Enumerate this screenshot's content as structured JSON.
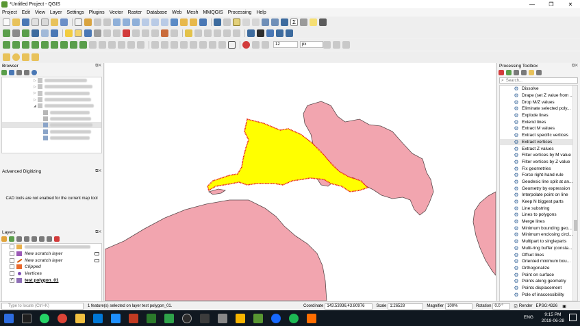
{
  "window": {
    "title": "*Untitled Project - QGIS",
    "controls": [
      "—",
      "❐",
      "✕"
    ]
  },
  "menu": [
    "Project",
    "Edit",
    "View",
    "Layer",
    "Settings",
    "Plugins",
    "Vector",
    "Raster",
    "Database",
    "Web",
    "Mesh",
    "MMQGIS",
    "Processing",
    "Help"
  ],
  "snapping": {
    "tolerance": "12",
    "units": "px"
  },
  "browser": {
    "title": "Browser"
  },
  "advanced_digitizing": {
    "title": "Advanced Digitizing",
    "message": "CAD tools are not enabled for the current map tool"
  },
  "layers": {
    "title": "Layers",
    "items": [
      {
        "name": "New scratch layer",
        "checked": false,
        "symbol": "polygon-fill",
        "color": "#9b59b6"
      },
      {
        "name": "New scratch layer",
        "checked": false,
        "symbol": "line",
        "color": "#d35400"
      },
      {
        "name": "Clipped",
        "checked": false,
        "symbol": "polygon-fill",
        "color": "#e8692c"
      },
      {
        "name": "Vertices",
        "checked": false,
        "symbol": "point",
        "color": "#7b4bb3"
      },
      {
        "name": "test polygon_01",
        "checked": true,
        "symbol": "polygon-fill",
        "color": "#8e6fb6"
      }
    ]
  },
  "processing": {
    "title": "Processing Toolbox",
    "search_placeholder": "Search...",
    "algorithms": [
      "Dissolve",
      "Drape (set Z value from ...",
      "Drop M/Z values",
      "Eliminate selected poly...",
      "Explode lines",
      "Extend lines",
      "Extract M values",
      "Extract specific vertices",
      "Extract vertices",
      "Extract Z values",
      "Filter vertices by M value",
      "Filter vertices by Z value",
      "Fix geometries",
      "Force right-hand-rule",
      "Geodesic line split at an...",
      "Geometry by expression",
      "Interpolate point on line",
      "Keep N biggest parts",
      "Line substring",
      "Lines to polygons",
      "Merge lines",
      "Minimum bounding geo...",
      "Minimum enclosing circl...",
      "Multipart to singleparts",
      "Multi-ring buffer (consta...",
      "Offset lines",
      "Oriented minimum bou...",
      "Orthogonalize",
      "Point on surface",
      "Points along geometry",
      "Points displacement",
      "Pole of inaccessibility"
    ],
    "selected_index": 8
  },
  "map": {
    "land_color": "#f2a5af",
    "selected_fill": "#ffff00",
    "selected_outline": "#e8281e"
  },
  "status": {
    "locate_placeholder": "Type to locate (Ctrl+K)",
    "message": "1 feature(s) selected on layer test polygon_01.",
    "coordinate_label": "Coordinate",
    "coordinate": "143.53936,43.80976",
    "scale_label": "Scale",
    "scale": "1:26528",
    "magnifier_label": "Magnifier",
    "magnifier": "100%",
    "rotation_label": "Rotation",
    "rotation": "0.0 °",
    "render_label": "Render",
    "crs": "EPSG:4326"
  },
  "taskbar": {
    "lang": "ENG",
    "time": "9:15 PM",
    "date": "2019-06-28"
  }
}
